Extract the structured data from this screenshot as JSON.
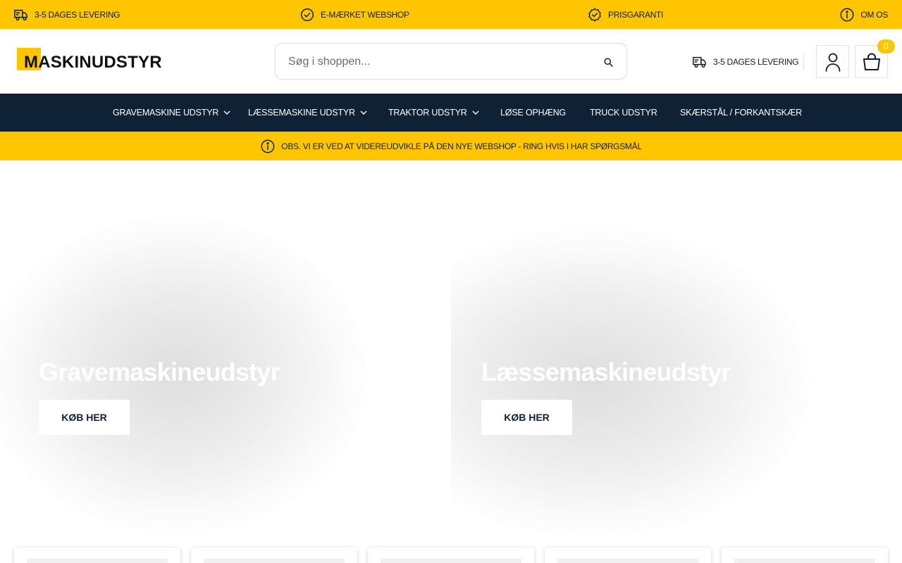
{
  "usp_bar": {
    "items": [
      {
        "label": "3-5 dages levering",
        "icon": "truck-icon"
      },
      {
        "label": "E-mærket webshop",
        "icon": "check-circle-icon"
      },
      {
        "label": "Prisgaranti",
        "icon": "badge-check-icon"
      },
      {
        "label": "Om os",
        "icon": "info-icon"
      }
    ]
  },
  "header": {
    "logo_text": "MASKINUDSTYR",
    "search": {
      "placeholder": "Søg i shoppen..."
    },
    "delivery_label": "3-5 dages levering",
    "cart_count": "0"
  },
  "nav": {
    "items": [
      {
        "label": "Gravemaskine udstyr",
        "has_dropdown": true
      },
      {
        "label": "Læssemaskine udstyr",
        "has_dropdown": true
      },
      {
        "label": "Traktor udstyr",
        "has_dropdown": true
      },
      {
        "label": "Løse ophæng",
        "has_dropdown": false
      },
      {
        "label": "Truck udstyr",
        "has_dropdown": false
      },
      {
        "label": "Skærstål / forkantskær",
        "has_dropdown": false
      }
    ]
  },
  "notice": {
    "text": "Obs. vi er ved at videreudvikle på den nye webshop - ring hvis i har spørgsmål",
    "icon": "info-icon"
  },
  "hero": {
    "banners": [
      {
        "title": "Gravemaskineudstyr",
        "cta": "KØB HER"
      },
      {
        "title": "Læssemaskineudstyr",
        "cta": "KØB HER"
      }
    ]
  },
  "colors": {
    "accent": "#ffc600",
    "navy": "#0f2135",
    "text": "#0e1f33"
  }
}
